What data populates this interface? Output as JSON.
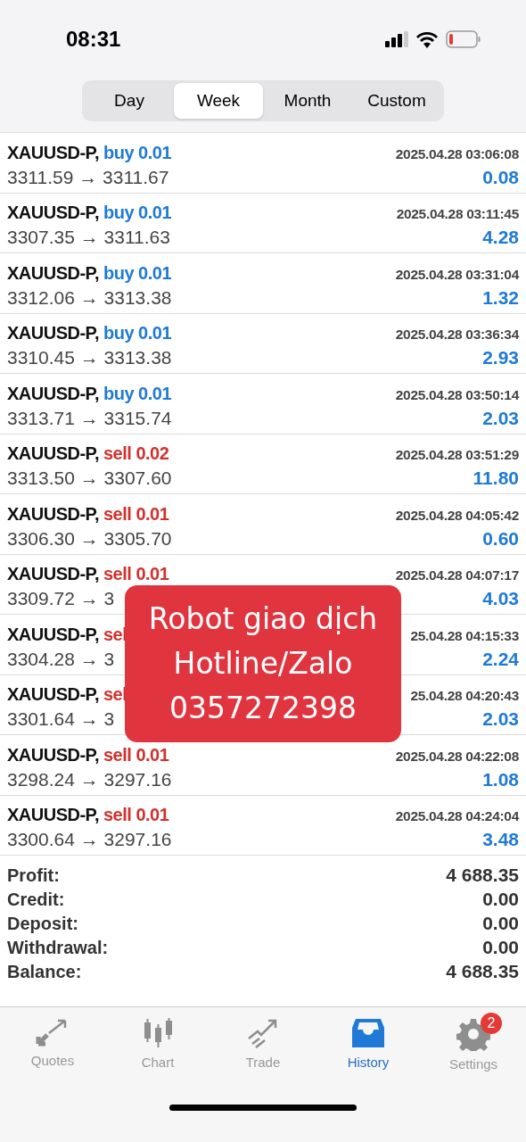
{
  "status_bar": {
    "time": "08:31",
    "battery_low": true
  },
  "period_tabs": [
    {
      "label": "Day",
      "selected": false
    },
    {
      "label": "Week",
      "selected": true
    },
    {
      "label": "Month",
      "selected": false
    },
    {
      "label": "Custom",
      "selected": false
    }
  ],
  "deals": [
    {
      "symbol": "XAUUSD-P,",
      "action": "buy 0.01",
      "kind": "buy",
      "time": "2025.04.28 03:06:08",
      "prices": "3311.59 → 3311.67",
      "profit": "0.08"
    },
    {
      "symbol": "XAUUSD-P,",
      "action": "buy 0.01",
      "kind": "buy",
      "time": "2025.04.28 03:11:45",
      "prices": "3307.35 → 3311.63",
      "profit": "4.28"
    },
    {
      "symbol": "XAUUSD-P,",
      "action": "buy 0.01",
      "kind": "buy",
      "time": "2025.04.28 03:31:04",
      "prices": "3312.06 → 3313.38",
      "profit": "1.32"
    },
    {
      "symbol": "XAUUSD-P,",
      "action": "buy 0.01",
      "kind": "buy",
      "time": "2025.04.28 03:36:34",
      "prices": "3310.45 → 3313.38",
      "profit": "2.93"
    },
    {
      "symbol": "XAUUSD-P,",
      "action": "buy 0.01",
      "kind": "buy",
      "time": "2025.04.28 03:50:14",
      "prices": "3313.71 → 3315.74",
      "profit": "2.03"
    },
    {
      "symbol": "XAUUSD-P,",
      "action": "sell 0.02",
      "kind": "sell",
      "time": "2025.04.28 03:51:29",
      "prices": "3313.50 → 3307.60",
      "profit": "11.80"
    },
    {
      "symbol": "XAUUSD-P,",
      "action": "sell 0.01",
      "kind": "sell",
      "time": "2025.04.28 04:05:42",
      "prices": "3306.30 → 3305.70",
      "profit": "0.60"
    },
    {
      "symbol": "XAUUSD-P,",
      "action": "sell 0.01",
      "kind": "sell",
      "time": "2025.04.28 04:07:17",
      "prices": "3309.72 → 3",
      "profit": "4.03"
    },
    {
      "symbol": "XAUUSD-P,",
      "action": "sel",
      "kind": "sell",
      "time": "25.04.28 04:15:33",
      "prices": "3304.28 → 3",
      "profit": "2.24"
    },
    {
      "symbol": "XAUUSD-P,",
      "action": "sel",
      "kind": "sell",
      "time": "25.04.28 04:20:43",
      "prices": "3301.64 → 3",
      "profit": "2.03"
    },
    {
      "symbol": "XAUUSD-P,",
      "action": "sell 0.01",
      "kind": "sell",
      "time": "2025.04.28 04:22:08",
      "prices": "3298.24 → 3297.16",
      "profit": "1.08"
    },
    {
      "symbol": "XAUUSD-P,",
      "action": "sell 0.01",
      "kind": "sell",
      "time": "2025.04.28 04:24:04",
      "prices": "3300.64 → 3297.16",
      "profit": "3.48"
    }
  ],
  "summary": [
    {
      "label": "Profit:",
      "value": "4 688.35"
    },
    {
      "label": "Credit:",
      "value": "0.00"
    },
    {
      "label": "Deposit:",
      "value": "0.00"
    },
    {
      "label": "Withdrawal:",
      "value": "0.00"
    },
    {
      "label": "Balance:",
      "value": "4 688.35"
    }
  ],
  "promo_sticker": {
    "lines": [
      "Robot giao dịch",
      "Hotline/Zalo",
      "0357272398"
    ]
  },
  "nav_tabs": [
    {
      "label": "Quotes",
      "kind": "quotes",
      "selected": false
    },
    {
      "label": "Chart",
      "kind": "chart",
      "selected": false
    },
    {
      "label": "Trade",
      "kind": "trade",
      "selected": false
    },
    {
      "label": "History",
      "kind": "history",
      "selected": true
    },
    {
      "label": "Settings",
      "kind": "settings",
      "selected": false,
      "badge": "2"
    }
  ]
}
